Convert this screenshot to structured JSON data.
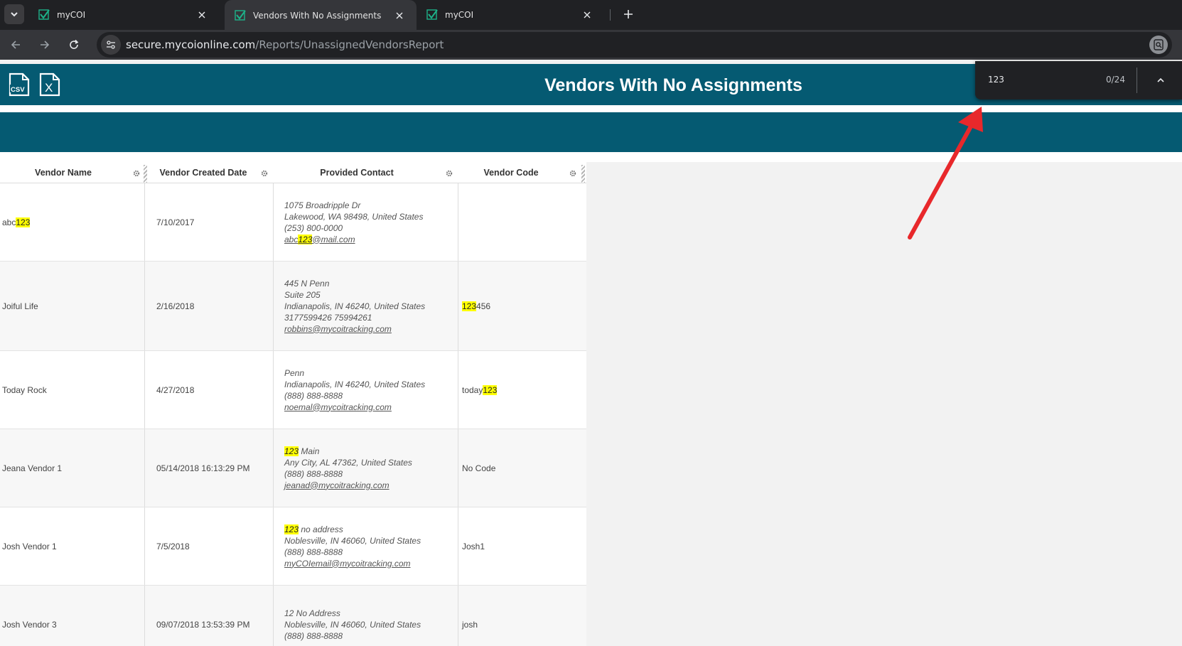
{
  "browser": {
    "tabs": [
      {
        "title": "myCOI",
        "active": false
      },
      {
        "title": "Vendors With No Assignments",
        "active": true
      },
      {
        "title": "myCOI",
        "active": false
      }
    ],
    "url_domain": "secure.mycoionline.com",
    "url_path": "/Reports/UnassignedVendorsReport",
    "favicon_color": "#1db38a"
  },
  "page": {
    "title": "Vendors With No Assignments",
    "export_csv_label": "CSV",
    "export_excel_label": "X",
    "header_color": "#055a72"
  },
  "grid": {
    "columns": [
      {
        "label": "Vendor Name"
      },
      {
        "label": "Vendor Created Date"
      },
      {
        "label": "Provided Contact"
      },
      {
        "label": "Vendor Code"
      }
    ],
    "rows": [
      {
        "name": [
          "abc",
          "123",
          ""
        ],
        "created": "7/10/2017",
        "contact": [
          [
            "1075 Broadripple Dr",
            "",
            ""
          ],
          [
            "Lakewood, WA 98498, United States",
            "",
            ""
          ],
          [
            "(253) 800-0000",
            "",
            ""
          ]
        ],
        "email": [
          "abc",
          "123",
          "@mail.com"
        ],
        "code": [
          "",
          "",
          ""
        ]
      },
      {
        "name": [
          "Joiful Life",
          "",
          ""
        ],
        "created": "2/16/2018",
        "contact": [
          [
            "445 N Penn",
            "",
            ""
          ],
          [
            "Suite 205",
            "",
            ""
          ],
          [
            "Indianapolis, IN 46240, United States",
            "",
            ""
          ],
          [
            "3177599426 75994261",
            "",
            ""
          ]
        ],
        "email": [
          "robbins@mycoitracking.com",
          "",
          ""
        ],
        "code": [
          "",
          "123",
          "456"
        ]
      },
      {
        "name": [
          "Today Rock",
          "",
          ""
        ],
        "created": "4/27/2018",
        "contact": [
          [
            "Penn",
            "",
            ""
          ],
          [
            "Indianapolis, IN 46240, United States",
            "",
            ""
          ],
          [
            "(888) 888-8888",
            "",
            ""
          ]
        ],
        "email": [
          "noemal@mycoitracking.com",
          "",
          ""
        ],
        "code": [
          "today",
          "123",
          ""
        ]
      },
      {
        "name": [
          "Jeana Vendor 1",
          "",
          ""
        ],
        "created": "05/14/2018 16:13:29 PM",
        "contact": [
          [
            "",
            "123",
            " Main"
          ],
          [
            "Any City, AL 47362, United States",
            "",
            ""
          ],
          [
            "(888) 888-8888",
            "",
            ""
          ]
        ],
        "email": [
          "jeanad@mycoitracking.com",
          "",
          ""
        ],
        "code": [
          "No Code",
          "",
          ""
        ]
      },
      {
        "name": [
          "Josh Vendor 1",
          "",
          ""
        ],
        "created": "7/5/2018",
        "contact": [
          [
            "",
            "123",
            " no address"
          ],
          [
            "Noblesville, IN 46060, United States",
            "",
            ""
          ],
          [
            "(888) 888-8888",
            "",
            ""
          ]
        ],
        "email": [
          "myCOIemail@mycoitracking.com",
          "",
          ""
        ],
        "code": [
          "Josh1",
          "",
          ""
        ]
      },
      {
        "name": [
          "Josh Vendor 3",
          "",
          ""
        ],
        "created": "09/07/2018 13:53:39 PM",
        "contact": [
          [
            "12 No Address",
            "",
            ""
          ],
          [
            "Noblesville, IN 46060, United States",
            "",
            ""
          ],
          [
            "(888) 888-8888",
            "",
            ""
          ]
        ],
        "email": [
          "",
          "",
          ""
        ],
        "code": [
          "josh",
          "",
          ""
        ]
      }
    ]
  },
  "find_bar": {
    "query": "123",
    "count": "0/24"
  },
  "annotation": {
    "arrow_color": "#e8282b"
  }
}
